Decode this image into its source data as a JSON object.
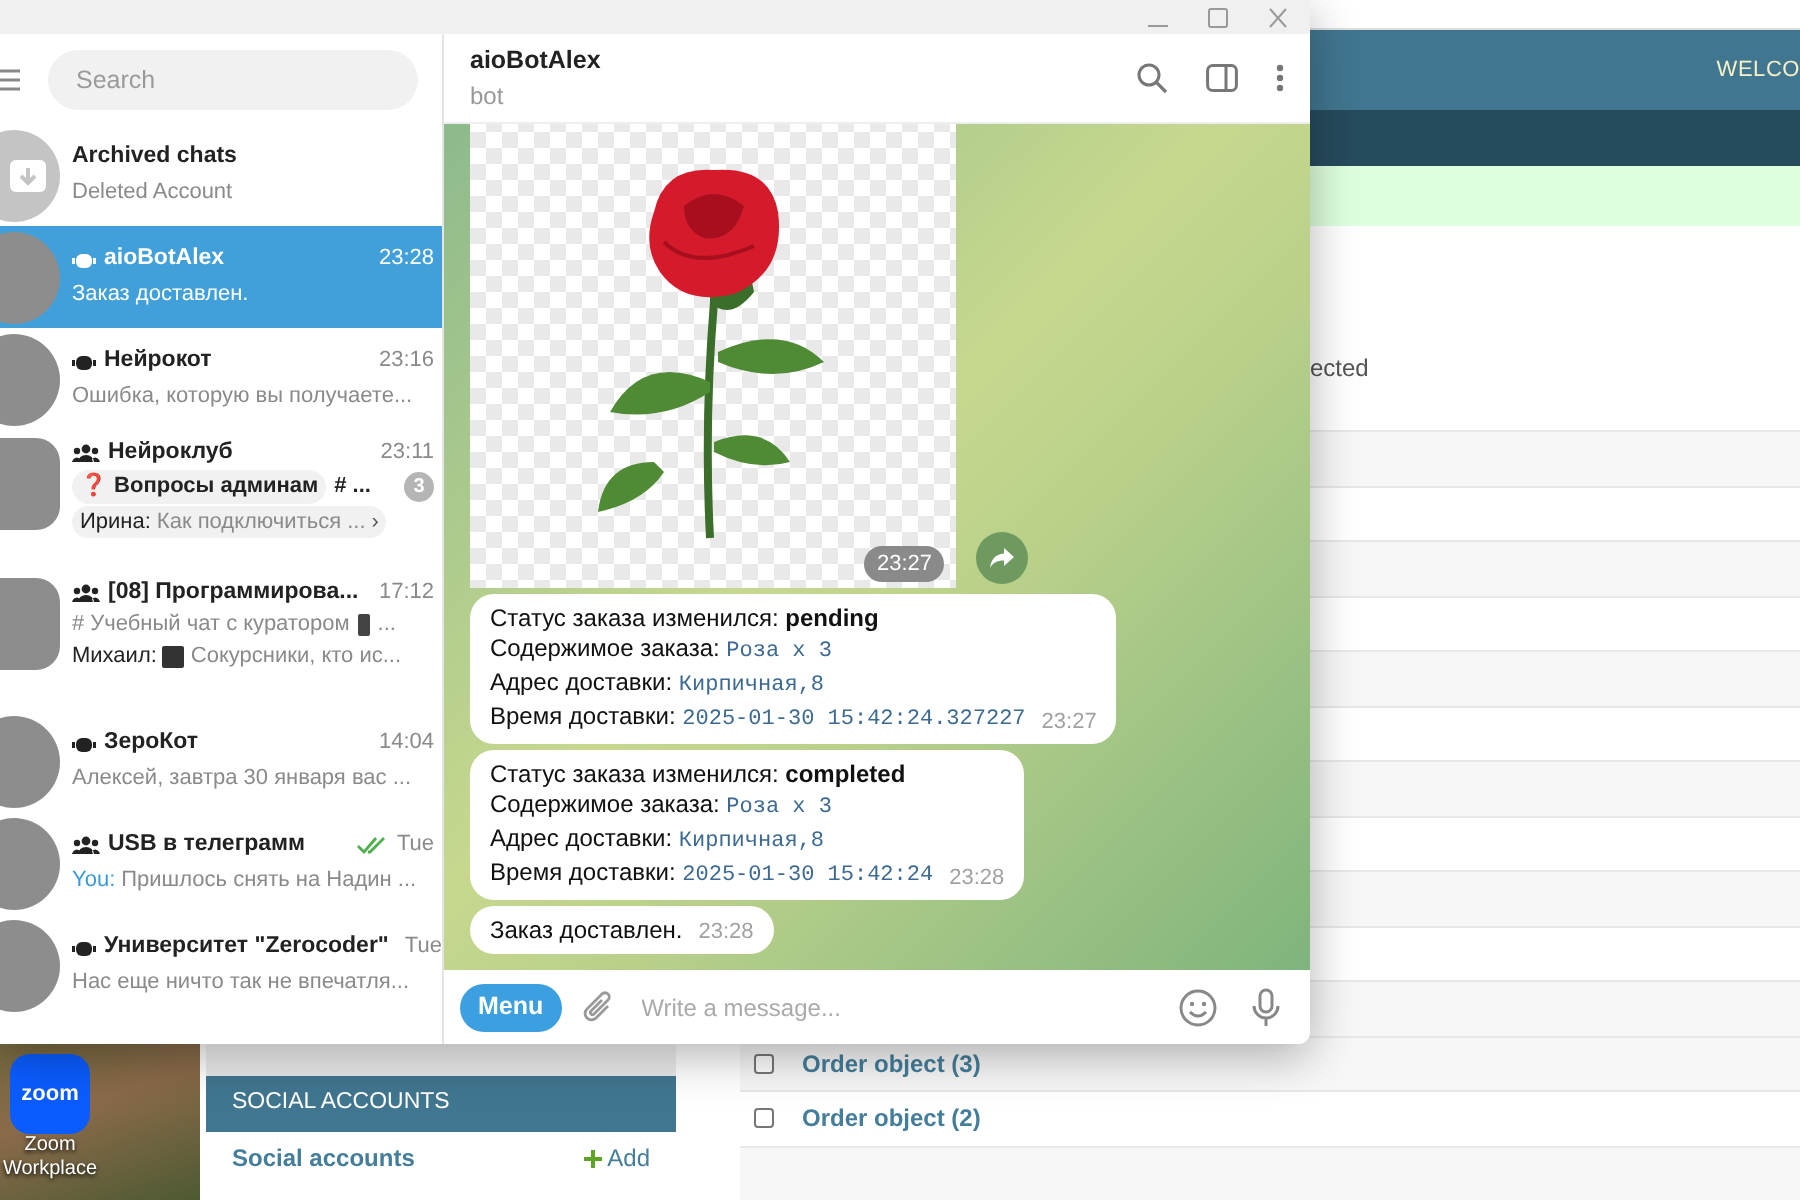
{
  "desktop": {
    "shortcut": {
      "icon_text": "zoom",
      "label": "Zoom Workplace"
    }
  },
  "admin": {
    "header": {
      "text": "WELCO"
    },
    "partial_text": "ected",
    "sidebar": {
      "section": "SOCIAL ACCOUNTS",
      "link": "Social accounts",
      "add": "Add"
    },
    "rows": [
      {
        "label": "Order object (3)",
        "checked": false
      },
      {
        "label": "Order object (2)",
        "checked": false
      }
    ]
  },
  "telegram": {
    "search": {
      "placeholder": "Search"
    },
    "chats": [
      {
        "kind": "archive",
        "name": "Archived chats",
        "preview": "Deleted Account",
        "selected": false
      },
      {
        "kind": "bot",
        "name": "aioBotAlex",
        "time": "23:28",
        "preview": "Заказ доставлен.",
        "read": false,
        "media": false,
        "selected": true
      },
      {
        "kind": "bot",
        "name": "Нейрокот",
        "time": "23:16",
        "preview": "Ошибка, которую вы получаете...",
        "read": false,
        "media": false,
        "selected": false
      },
      {
        "kind": "forum",
        "name": "Нейроклуб",
        "time": "23:11",
        "topic": "❓ Вопросы админам",
        "other_topic": "# ...",
        "unread": "3",
        "sender": "Ирина:",
        "own": false,
        "preview": "Как подключиться ...",
        "arrow": "›",
        "read": false,
        "media": false,
        "selected": false
      },
      {
        "kind": "group",
        "name": "[08] Программирова...",
        "time": "17:12",
        "topic_line": "# Учебный чат с куратором",
        "topic_more": "...",
        "sender": "Михаил:",
        "own": false,
        "preview": "Сокурсники, кто ис...",
        "read": false,
        "media": true,
        "selected": false
      },
      {
        "kind": "bot",
        "name": "ЗероКот",
        "time": "14:04",
        "preview": "Алексей, завтра 30 января  вас ...",
        "read": false,
        "media": false,
        "selected": false
      },
      {
        "kind": "group",
        "name": "USB в телеграмм",
        "time": "Tue",
        "sender": "You:",
        "own": true,
        "preview": "Пришлось снять на Надин ...",
        "read": true,
        "media": false,
        "selected": false
      },
      {
        "kind": "bot",
        "name": "Университет \"Zerocoder\"",
        "time": "Tue",
        "preview": "Нас еще ничто так не впечатля...",
        "read": false,
        "media": false,
        "selected": false
      }
    ],
    "chat": {
      "title": "aioBotAlex",
      "status": "bot",
      "messages": [
        {
          "kind": "sticker",
          "time": "23:27"
        },
        {
          "kind": "text",
          "time": "23:27",
          "lines": [
            {
              "label": "Статус заказа изменился:",
              "value": "pending",
              "kind": "bold"
            },
            {
              "label": "Содержимое заказа:",
              "value": "Роза x 3",
              "kind": "code"
            },
            {
              "label": "Адрес доставки:",
              "value": "Кирпичная,8",
              "kind": "code"
            },
            {
              "label": "Время доставки:",
              "value": "2025-01-30 15:42:24.327227",
              "kind": "code"
            }
          ]
        },
        {
          "kind": "text",
          "time": "23:28",
          "lines": [
            {
              "label": "Статус заказа изменился:",
              "value": "completed",
              "kind": "bold"
            },
            {
              "label": "Содержимое заказа:",
              "value": "Роза x 3",
              "kind": "code"
            },
            {
              "label": "Адрес доставки:",
              "value": "Кирпичная,8",
              "kind": "code"
            },
            {
              "label": "Время доставки:",
              "value": "2025-01-30 15:42:24",
              "kind": "code"
            }
          ]
        },
        {
          "kind": "text",
          "time": "23:28",
          "lines": [
            {
              "label": "Заказ доставлен."
            }
          ]
        }
      ],
      "composer": {
        "menu": "Menu",
        "placeholder": "Write a message..."
      }
    }
  }
}
